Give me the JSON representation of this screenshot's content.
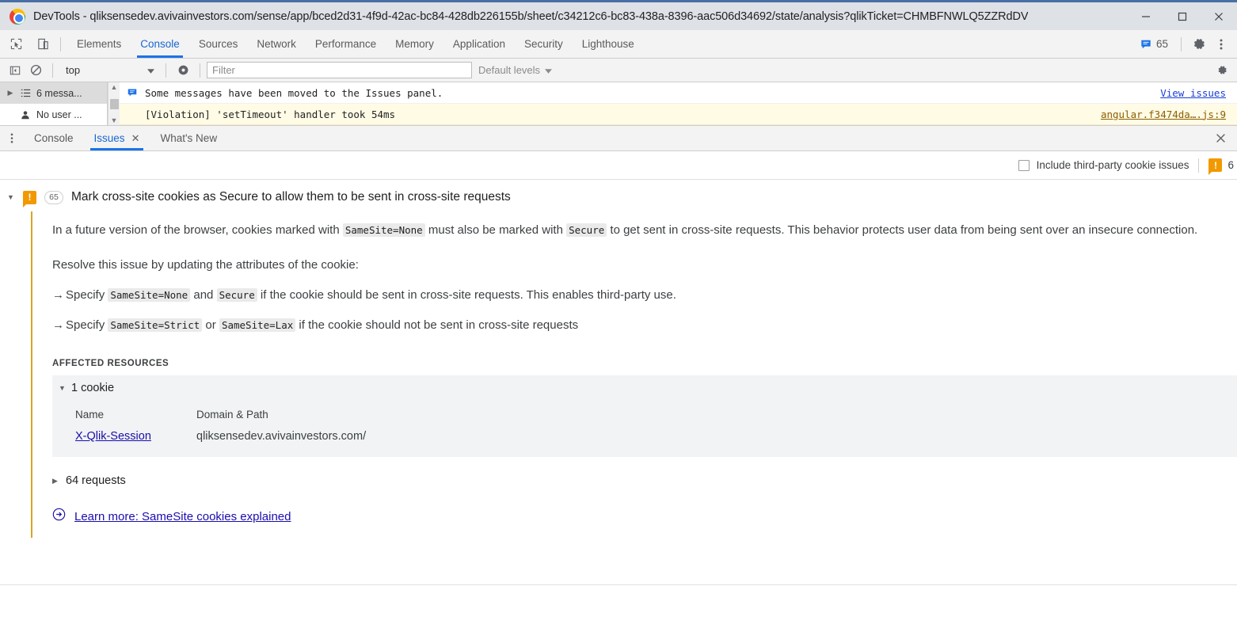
{
  "window": {
    "title": "DevTools - qliksensedev.avivainvestors.com/sense/app/bced2d31-4f9d-42ac-bc84-428db226155b/sheet/c34212c6-bc83-438a-8396-aac506d34692/state/analysis?qlikTicket=CHMBFNWLQ5ZZRdDV",
    "minimize_label": "Minimize",
    "maximize_label": "Maximize",
    "close_label": "Close",
    "logo": "chrome-logo"
  },
  "main_tabs": {
    "inspect_icon": "inspect-element-icon",
    "device_icon": "device-toolbar-icon",
    "items": [
      {
        "label": "Elements",
        "active": false
      },
      {
        "label": "Console",
        "active": true
      },
      {
        "label": "Sources",
        "active": false
      },
      {
        "label": "Network",
        "active": false
      },
      {
        "label": "Performance",
        "active": false
      },
      {
        "label": "Memory",
        "active": false
      },
      {
        "label": "Application",
        "active": false
      },
      {
        "label": "Security",
        "active": false
      },
      {
        "label": "Lighthouse",
        "active": false
      }
    ],
    "message_count": "65",
    "message_icon": "message-bubble-icon",
    "settings_icon": "gear-icon",
    "more_icon": "more-vertical-icon"
  },
  "console_toolbar": {
    "sidebar_icon": "show-console-sidebar-icon",
    "clear_icon": "clear-console-icon",
    "context": "top",
    "context_caret": "chevron-down-icon",
    "eye_icon": "live-expression-icon",
    "filter_placeholder": "Filter",
    "filter_value": "",
    "levels": "Default levels",
    "levels_caret": "chevron-down-icon",
    "settings_icon": "console-settings-icon"
  },
  "console_sidebar": {
    "items": [
      {
        "label": "6 messa...",
        "icon": "list-icon",
        "selected": true,
        "caret": "chevron-right-icon"
      },
      {
        "label": "No user ...",
        "icon": "person-icon",
        "selected": false,
        "caret": ""
      }
    ],
    "scroll_up": "scroll-up-arrow",
    "scroll_down": "scroll-down-arrow"
  },
  "console_messages": [
    {
      "icon": "info-message-icon",
      "text": "Some messages have been moved to the Issues panel.",
      "link": "View issues",
      "link_style": "blue",
      "violation": false
    },
    {
      "icon": "",
      "text": "[Violation] 'setTimeout' handler took 54ms",
      "link": "angular.f3474da….js:9",
      "link_style": "brown",
      "violation": true
    }
  ],
  "drawer_tabs": {
    "more_icon": "more-vertical-icon",
    "items": [
      {
        "label": "Console",
        "active": false,
        "closable": false
      },
      {
        "label": "Issues",
        "active": true,
        "closable": true,
        "close_glyph": "✕"
      },
      {
        "label": "What's New",
        "active": false,
        "closable": false
      }
    ],
    "close_drawer_icon": "close-icon",
    "close_drawer_glyph": "✕"
  },
  "issues_bar": {
    "third_party_checkbox_label": "Include third-party cookie issues",
    "third_party_checked": false,
    "warning_icon": "warning-icon",
    "warning_count": "6"
  },
  "issue": {
    "expand_caret": "chevron-down-icon",
    "severity_icon": "warning-icon",
    "severity_glyph": "!",
    "count": "65",
    "title": "Mark cross-site cookies as Secure to allow them to be sent in cross-site requests",
    "paragraph": {
      "part1": "In a future version of the browser, cookies marked with ",
      "code1": "SameSite=None",
      "part2": " must also be marked with ",
      "code2": "Secure",
      "part3": " to get sent in cross-site requests. This behavior protects user data from being sent over an insecure connection."
    },
    "resolve_intro": "Resolve this issue by updating the attributes of the cookie:",
    "bullets": [
      {
        "arrow": "→",
        "part1": "Specify ",
        "code1": "SameSite=None",
        "part2": " and ",
        "code2": "Secure",
        "part3": " if the cookie should be sent in cross-site requests. This enables third-party use."
      },
      {
        "arrow": "→",
        "part1": "Specify ",
        "code1": "SameSite=Strict",
        "part2": " or ",
        "code2": "SameSite=Lax",
        "part3": " if the cookie should not be sent in cross-site requests"
      }
    ],
    "affected_resources_label": "AFFECTED RESOURCES",
    "cookies": {
      "toggle_caret": "chevron-down-icon",
      "toggle_label": "1 cookie",
      "columns": [
        "Name",
        "Domain & Path"
      ],
      "rows": [
        {
          "name": "X-Qlik-Session",
          "domain": "qliksensedev.avivainvestors.com/"
        }
      ]
    },
    "requests": {
      "toggle_caret": "chevron-right-icon",
      "toggle_label": "64 requests"
    },
    "learn_more": {
      "icon": "arrow-circle-right-icon",
      "label": "Learn more: SameSite cookies explained"
    }
  }
}
